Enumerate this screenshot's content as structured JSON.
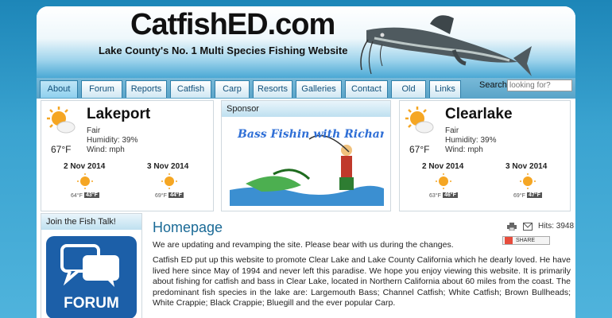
{
  "header": {
    "site_title": "CatfishED.com",
    "tagline": "Lake County's No. 1 Multi Species Fishing Website"
  },
  "nav": {
    "tabs": [
      {
        "label": "About",
        "active": true
      },
      {
        "label": "Forum"
      },
      {
        "label": "Reports"
      },
      {
        "label": "Catfish"
      },
      {
        "label": "Carp"
      },
      {
        "label": "Resorts"
      },
      {
        "label": "Galleries"
      },
      {
        "label": "Contact"
      },
      {
        "label": "Old"
      },
      {
        "label": "Links"
      }
    ],
    "search_label": "Search",
    "search_placeholder": "looking for?"
  },
  "weather_left": {
    "city": "Lakeport",
    "condition": "Fair",
    "humidity": "Humidity: 39%",
    "wind": "Wind: mph",
    "current_temp": "67°F",
    "forecast": [
      {
        "date": "2 Nov 2014",
        "low": "64°F",
        "high": "43°F"
      },
      {
        "date": "3 Nov 2014",
        "low": "69°F",
        "high": "44°F"
      }
    ]
  },
  "sponsor": {
    "title": "Sponsor",
    "banner_text": "Bass Fishin with Richard"
  },
  "weather_right": {
    "city": "Clearlake",
    "condition": "Fair",
    "humidity": "Humidity: 39%",
    "wind": "Wind: mph",
    "current_temp": "67°F",
    "forecast": [
      {
        "date": "2 Nov 2014",
        "low": "63°F",
        "high": "46°F"
      },
      {
        "date": "3 Nov 2014",
        "low": "69°F",
        "high": "47°F"
      }
    ]
  },
  "fish_talk": {
    "title": "Join the Fish Talk!",
    "button_label": "FORUM"
  },
  "main": {
    "title": "Homepage",
    "hits": "Hits: 3948",
    "share_label": "SHARE",
    "intro": "We are updating and revamping the site. Please bear with us during the changes.",
    "body": "Catfish ED put up this website to promote Clear Lake and Lake County California which he dearly loved. He have lived here since May of 1994 and never left this paradise. We hope you enjoy viewing this website. It is primarily about fishing for catfish and bass in Clear Lake, located in Northern California about 60 miles from the coast. The predominant fish species in the lake are: Largemouth Bass; Channel Catfish; White Catfish; Brown Bullheads; White Crappie; Black Crappie; Bluegill and the ever popular Carp."
  },
  "colors": {
    "accent": "#1a6a96",
    "nav_border": "#2e7ea8",
    "sun": "#f5a623"
  }
}
